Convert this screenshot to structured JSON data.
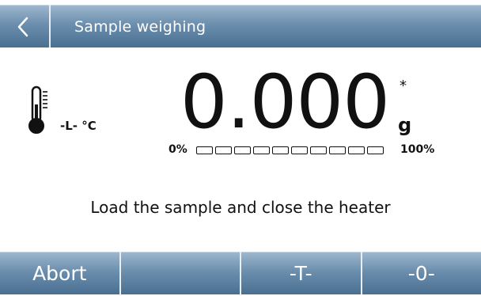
{
  "header": {
    "title": "Sample weighing"
  },
  "display": {
    "weight": "0.000",
    "stability_mark": "*",
    "unit": "g",
    "temperature_label": "-L- °C",
    "range_min_label": "0%",
    "range_max_label": "100%",
    "range_segments": 10,
    "range_fill_fraction": 0
  },
  "message": "Load the sample and close the heater",
  "footer": {
    "buttons": [
      {
        "label": "Abort"
      },
      {
        "label": ""
      },
      {
        "label": "-T-"
      },
      {
        "label": "-0-"
      }
    ]
  },
  "colors": {
    "bar_top": "#9fb8cf",
    "bar_bottom": "#4a6f91",
    "text": "#111111"
  }
}
